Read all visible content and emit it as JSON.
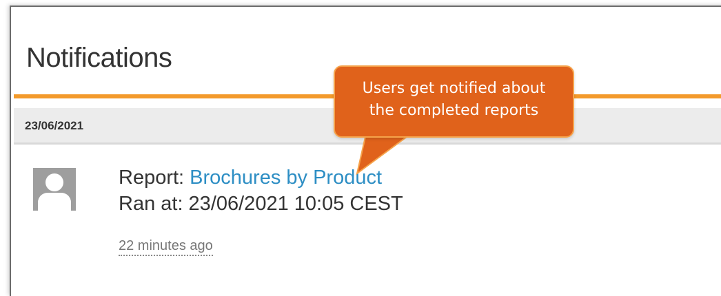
{
  "header": {
    "title": "Notifications"
  },
  "group": {
    "date": "23/06/2021"
  },
  "notification": {
    "report_prefix": "Report: ",
    "report_name": "Brochures by Product",
    "ran_at": "Ran at: 23/06/2021 10:05 CEST",
    "relative_time": "22 minutes ago"
  },
  "callout": {
    "line1": "Users get notified about",
    "line2": "the completed reports"
  },
  "colors": {
    "accent_orange": "#f39a2b",
    "callout_fill": "#e0621b",
    "link_blue": "#2d8ec4"
  },
  "icons": {
    "avatar": "user-avatar-icon"
  }
}
